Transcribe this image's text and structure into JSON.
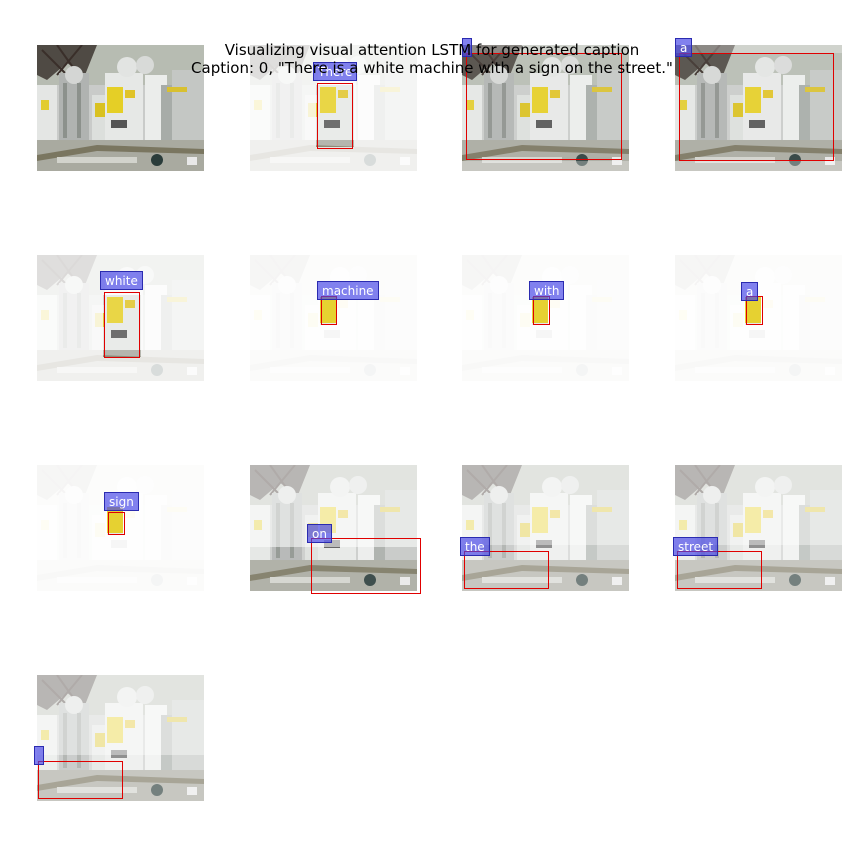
{
  "figure": {
    "title": "Visualizing visual attention LSTM for generated caption",
    "caption_line": "Caption: 0, \"There is a white machine with a sign on the street.\""
  },
  "panels": [
    {
      "word": "",
      "attention": "none"
    },
    {
      "word": "There",
      "attention": "machine-center"
    },
    {
      "word": "",
      "attention": "whole-image"
    },
    {
      "word": "a",
      "attention": "whole-image"
    },
    {
      "word": "white",
      "attention": "machine-center"
    },
    {
      "word": "machine",
      "attention": "yellow-sign"
    },
    {
      "word": "with",
      "attention": "yellow-sign"
    },
    {
      "word": "a",
      "attention": "yellow-sign"
    },
    {
      "word": "sign",
      "attention": "yellow-sign"
    },
    {
      "word": "on",
      "attention": "ground-right"
    },
    {
      "word": "the",
      "attention": "ground"
    },
    {
      "word": "street",
      "attention": "ground"
    },
    {
      "word": "",
      "attention": "ground"
    }
  ],
  "colors": {
    "attention_box": "#e00000",
    "word_label_fill": "#4646e6",
    "word_label_text": "#ffffff"
  }
}
